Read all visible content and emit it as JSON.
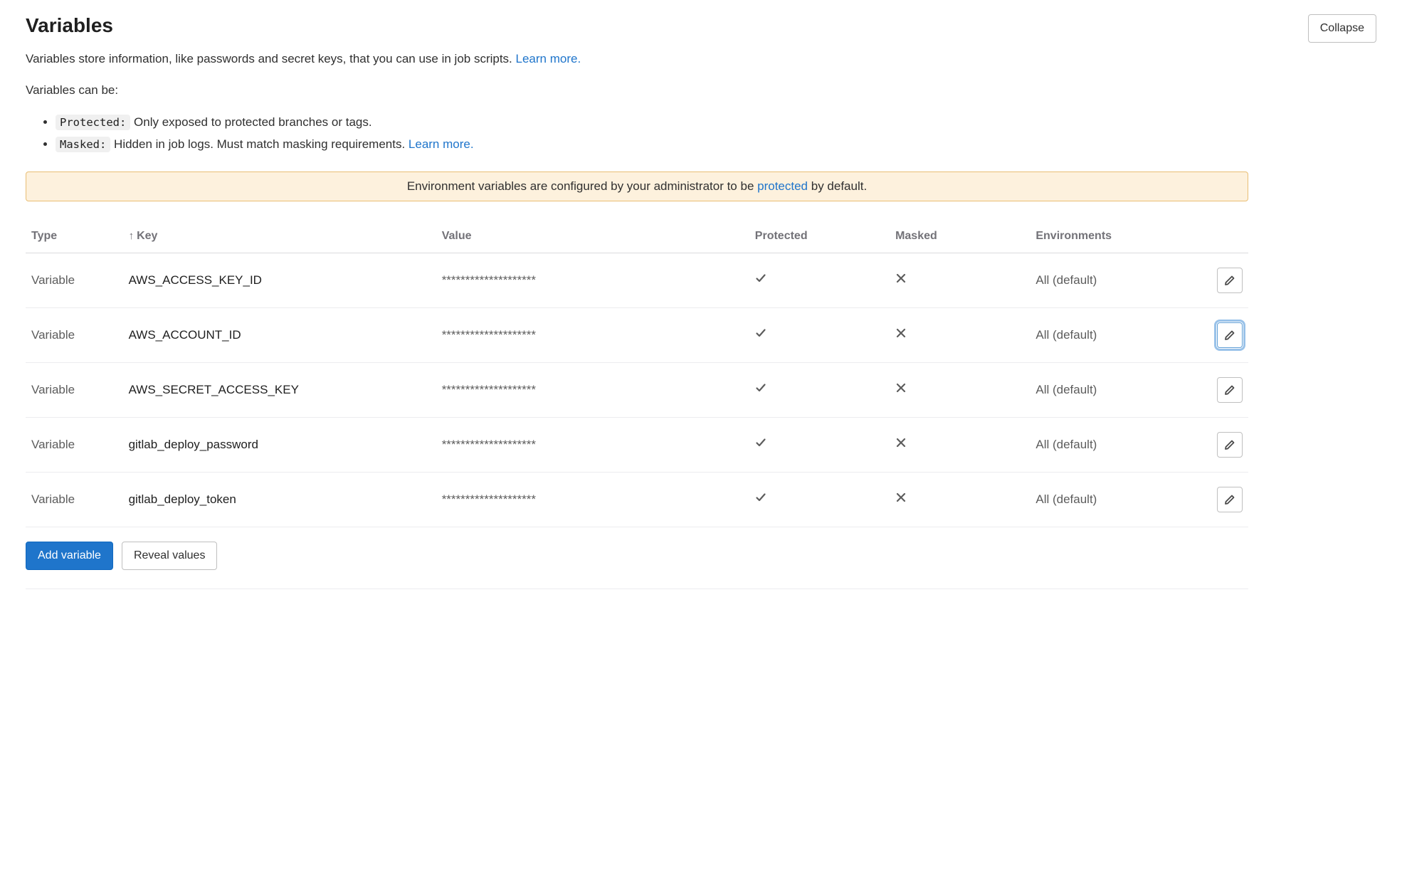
{
  "header": {
    "title": "Variables",
    "collapse_label": "Collapse"
  },
  "description": {
    "intro_text": "Variables store information, like passwords and secret keys, that you can use in job scripts. ",
    "intro_learn_more": "Learn more.",
    "can_be_text": "Variables can be:",
    "bullets": {
      "protected_tag": "Protected:",
      "protected_text": " Only exposed to protected branches or tags.",
      "masked_tag": "Masked:",
      "masked_text": " Hidden in job logs. Must match masking requirements. ",
      "masked_learn_more": "Learn more."
    }
  },
  "alert": {
    "prefix": "Environment variables are configured by your administrator to be ",
    "link": "protected",
    "suffix": " by default."
  },
  "table": {
    "headers": {
      "type": "Type",
      "key": "Key",
      "value": "Value",
      "protected": "Protected",
      "masked": "Masked",
      "environments": "Environments"
    },
    "rows": [
      {
        "type": "Variable",
        "key": "AWS_ACCESS_KEY_ID",
        "value": "********************",
        "protected": true,
        "masked": false,
        "env": "All (default)",
        "focused": false
      },
      {
        "type": "Variable",
        "key": "AWS_ACCOUNT_ID",
        "value": "********************",
        "protected": true,
        "masked": false,
        "env": "All (default)",
        "focused": true
      },
      {
        "type": "Variable",
        "key": "AWS_SECRET_ACCESS_KEY",
        "value": "********************",
        "protected": true,
        "masked": false,
        "env": "All (default)",
        "focused": false
      },
      {
        "type": "Variable",
        "key": "gitlab_deploy_password",
        "value": "********************",
        "protected": true,
        "masked": false,
        "env": "All (default)",
        "focused": false
      },
      {
        "type": "Variable",
        "key": "gitlab_deploy_token",
        "value": "********************",
        "protected": true,
        "masked": false,
        "env": "All (default)",
        "focused": false
      }
    ]
  },
  "actions": {
    "add_variable": "Add variable",
    "reveal_values": "Reveal values"
  }
}
